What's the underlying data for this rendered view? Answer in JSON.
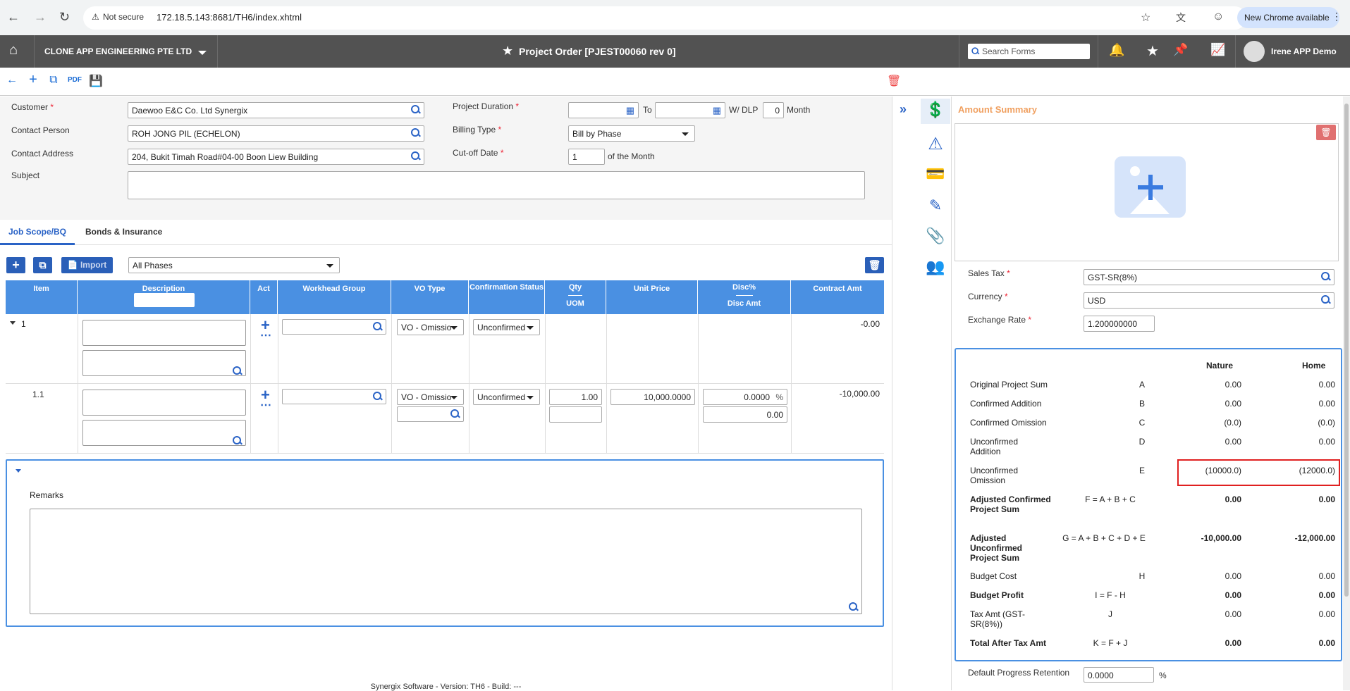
{
  "browser": {
    "security": "Not secure",
    "url": "172.18.5.143:8681/TH6/index.xhtml",
    "chrome_update": "New Chrome available"
  },
  "header": {
    "company": "CLONE APP ENGINEERING PTE LTD",
    "title": "Project Order [PJEST00060 rev 0]",
    "search_placeholder": "Search Forms",
    "user": "Irene APP Demo"
  },
  "form": {
    "customer_label": "Customer",
    "customer_value": "Daewoo E&C Co. Ltd Synergix",
    "contact_person_label": "Contact Person",
    "contact_person_value": "ROH JONG PIL (ECHELON)",
    "contact_address_label": "Contact Address",
    "contact_address_value": "204, Bukit Timah Road#04-00 Boon Liew Building",
    "subject_label": "Subject",
    "project_duration_label": "Project Duration",
    "to_label": "To",
    "wdlp_label": "W/ DLP",
    "wdlp_value": "0",
    "month_label": "Month",
    "billing_type_label": "Billing Type",
    "billing_type_value": "Bill by Phase",
    "cutoff_label": "Cut-off Date",
    "cutoff_value": "1",
    "of_month_label": "of the Month"
  },
  "tabs": [
    {
      "label": "Job Scope/BQ",
      "active": true
    },
    {
      "label": "Bonds & Insurance",
      "active": false
    }
  ],
  "grid": {
    "import_label": "Import",
    "phase_filter": "All Phases",
    "headers": {
      "item": "Item",
      "description": "Description",
      "act": "Act",
      "workhead": "Workhead Group",
      "vo_type": "VO Type",
      "confirmation": "Confirmation Status",
      "qty": "Qty",
      "uom": "UOM",
      "unit_price": "Unit Price",
      "disc": "Disc%",
      "disc_amt": "Disc Amt",
      "contract_amt": "Contract Amt"
    },
    "rows": [
      {
        "item": "1",
        "vo_type": "VO - Omissio",
        "status": "Unconfirmed",
        "qty": "",
        "unit_price": "",
        "disc": "",
        "disc_amt": "",
        "contract_amt": "-0.00"
      },
      {
        "item": "1.1",
        "vo_type": "VO - Omissio",
        "status": "Unconfirmed",
        "qty": "1.00",
        "unit_price": "10,000.0000",
        "disc": "0.0000",
        "disc_pct": "%",
        "disc_amt": "0.00",
        "contract_amt": "-10,000.00"
      }
    ],
    "remarks_label": "Remarks"
  },
  "right_panel": {
    "title": "Amount Summary",
    "sales_tax_label": "Sales Tax",
    "sales_tax_value": "GST-SR(8%)",
    "currency_label": "Currency",
    "currency_value": "USD",
    "exchange_rate_label": "Exchange Rate",
    "exchange_rate_value": "1.200000000",
    "col_nature": "Nature",
    "col_home": "Home",
    "summary": [
      {
        "label": "Original Project Sum",
        "code": "A",
        "nature": "0.00",
        "home": "0.00",
        "bold": false
      },
      {
        "label": "Confirmed Addition",
        "code": "B",
        "nature": "0.00",
        "home": "0.00",
        "bold": false
      },
      {
        "label": "Confirmed Omission",
        "code": "C",
        "nature": "(0.0)",
        "home": "(0.0)",
        "bold": false
      },
      {
        "label": "Unconfirmed Addition",
        "code": "D",
        "nature": "0.00",
        "home": "0.00",
        "bold": false
      },
      {
        "label": "Unconfirmed Omission",
        "code": "E",
        "nature": "(10000.0)",
        "home": "(12000.0)",
        "bold": false
      },
      {
        "label": "Adjusted Confirmed Project Sum",
        "code": "F = A + B + C",
        "nature": "0.00",
        "home": "0.00",
        "bold": true
      },
      {
        "label": "Adjusted Unconfirmed Project Sum",
        "code": "G = A + B + C + D + E",
        "nature": "-10,000.00",
        "home": "-12,000.00",
        "bold": true
      },
      {
        "label": "Budget Cost",
        "code": "H",
        "nature": "0.00",
        "home": "0.00",
        "bold": false
      },
      {
        "label": "Budget Profit",
        "code": "I = F - H",
        "nature": "0.00",
        "home": "0.00",
        "bold": true
      },
      {
        "label": "Tax Amt (GST-SR(8%))",
        "code": "J",
        "nature": "0.00",
        "home": "0.00",
        "bold": false
      },
      {
        "label": "Total After Tax Amt",
        "code": "K = F + J",
        "nature": "0.00",
        "home": "0.00",
        "bold": true
      }
    ],
    "retention_label": "Default Progress Retention",
    "retention_value": "0.0000",
    "retention_pct": "%"
  },
  "footer": "Synergix Software - Version: TH6 - Build: ---",
  "colors": {
    "accent": "#2a63c6",
    "header_bg": "#525252",
    "grid_header": "#4a90e2",
    "amount_title": "#f0a060",
    "highlight": "#e02020"
  }
}
